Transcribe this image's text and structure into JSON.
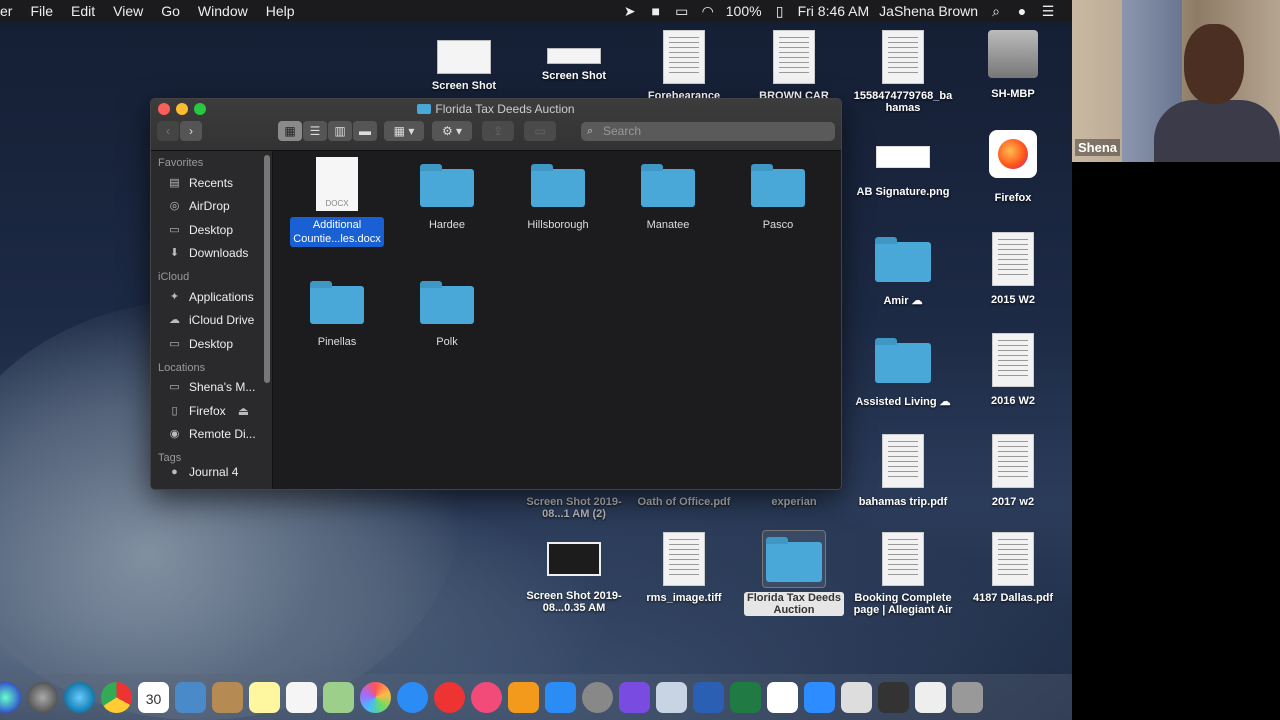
{
  "menubar": {
    "app_partial": "er",
    "menus": [
      "File",
      "Edit",
      "View",
      "Go",
      "Window",
      "Help"
    ],
    "battery": "100%",
    "clock": "Fri 8:46 AM",
    "user": "JaShena Brown"
  },
  "desktop": {
    "icons_top": [
      {
        "label": "Screen Shot",
        "kind": "shot"
      },
      {
        "label": "Screen Shot",
        "kind": "shot"
      },
      {
        "label": "Forebearance",
        "kind": "doc"
      },
      {
        "label": "BROWN CAR",
        "kind": "doc"
      },
      {
        "label": "1558474779768_bahamas",
        "kind": "doc"
      },
      {
        "label": "SH-MBP",
        "kind": "drive"
      }
    ],
    "ab_signature": "AB Signature.png",
    "firefox": "Firefox",
    "amir": "Amir",
    "w2_2015": "2015 W2",
    "assisted_living": "Assisted Living",
    "w2_2016": "2016 W2",
    "bahamas_trip": "bahamas trip.pdf",
    "w2_2017": "2017 w2",
    "shot_3": "Screen Shot 2019-08...1 AM (2)",
    "oath": "Oath of Office.pdf",
    "experian": "experian",
    "shot_4": "Screen Shot 2019-08...0.35 AM",
    "rms": "rms_image.tiff",
    "ftda": "Florida Tax Deeds Auction",
    "booking": "Booking Complete page | Allegiant Air",
    "dallas": "4187 Dallas.pdf"
  },
  "finder": {
    "title": "Florida Tax Deeds Auction",
    "search_placeholder": "Search",
    "sidebar": {
      "favorites_header": "Favorites",
      "favorites": [
        "Recents",
        "AirDrop",
        "Desktop",
        "Downloads"
      ],
      "icloud_header": "iCloud",
      "icloud": [
        "Applications",
        "iCloud Drive",
        "Desktop"
      ],
      "locations_header": "Locations",
      "locations": [
        "Shena's M...",
        "Firefox",
        "Remote Di..."
      ],
      "tags_header": "Tags",
      "tags_partial": "Journal 4"
    },
    "files": {
      "docx_badge": "DOCX",
      "docx_name_line1": "Additional",
      "docx_name_line2": "Countie...les.docx",
      "folders": [
        "Hardee",
        "Hillsborough",
        "Manatee",
        "Pasco",
        "Pinellas",
        "Polk"
      ]
    }
  },
  "webcam": {
    "name": "Shena"
  }
}
